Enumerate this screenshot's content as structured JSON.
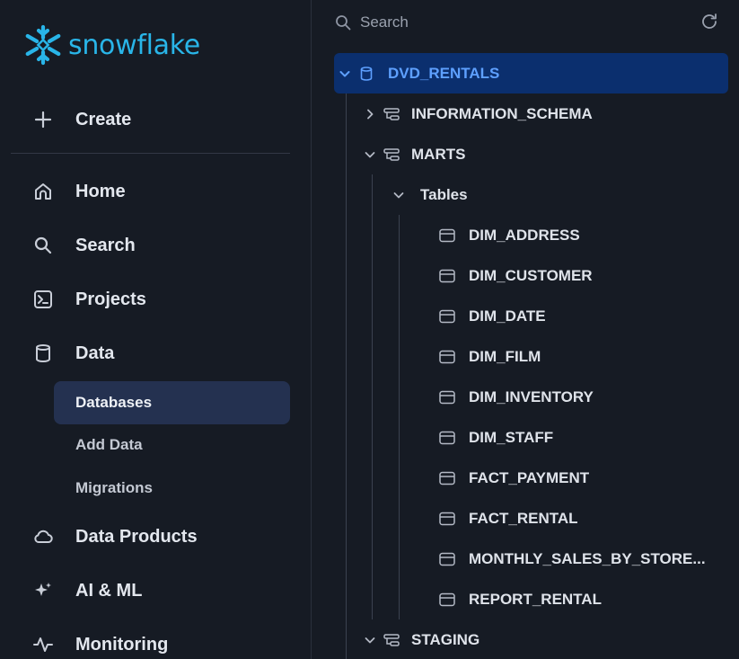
{
  "brand": {
    "name": "snowflake",
    "color": "#29b5e8"
  },
  "sidebar": {
    "create_label": "Create",
    "items": [
      {
        "label": "Home",
        "icon": "home-icon"
      },
      {
        "label": "Search",
        "icon": "search-icon"
      },
      {
        "label": "Projects",
        "icon": "terminal-icon"
      },
      {
        "label": "Data",
        "icon": "database-icon"
      }
    ],
    "data_subitems": [
      {
        "label": "Databases",
        "active": true
      },
      {
        "label": "Add Data",
        "active": false
      },
      {
        "label": "Migrations",
        "active": false
      }
    ],
    "more_items": [
      {
        "label": "Data Products",
        "icon": "cloud-icon"
      },
      {
        "label": "AI & ML",
        "icon": "sparkle-icon"
      },
      {
        "label": "Monitoring",
        "icon": "pulse-icon"
      }
    ]
  },
  "explorer": {
    "search_placeholder": "Search",
    "database": "DVD_RENTALS",
    "schemas": [
      {
        "name": "INFORMATION_SCHEMA",
        "expanded": false
      },
      {
        "name": "MARTS",
        "expanded": true
      },
      {
        "name": "STAGING",
        "expanded": true
      }
    ],
    "tables_group_label": "Tables",
    "tables": [
      "DIM_ADDRESS",
      "DIM_CUSTOMER",
      "DIM_DATE",
      "DIM_FILM",
      "DIM_INVENTORY",
      "DIM_STAFF",
      "FACT_PAYMENT",
      "FACT_RENTAL",
      "MONTHLY_SALES_BY_STORE...",
      "REPORT_RENTAL"
    ]
  }
}
